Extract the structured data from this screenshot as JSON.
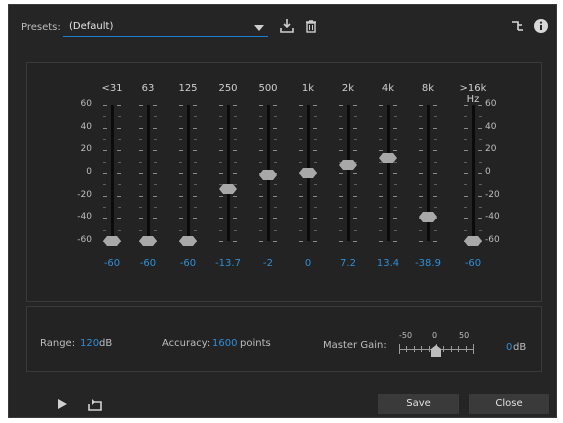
{
  "presets": {
    "label": "Presets:",
    "value": "(Default)"
  },
  "bands": [
    {
      "freq": "<31",
      "value": "-60",
      "gain": -60
    },
    {
      "freq": "63",
      "value": "-60",
      "gain": -60
    },
    {
      "freq": "125",
      "value": "-60",
      "gain": -60
    },
    {
      "freq": "250",
      "value": "-13.7",
      "gain": -13.7
    },
    {
      "freq": "500",
      "value": "-2",
      "gain": -2
    },
    {
      "freq": "1k",
      "value": "0",
      "gain": 0
    },
    {
      "freq": "2k",
      "value": "7.2",
      "gain": 7.2
    },
    {
      "freq": "4k",
      "value": "13.4",
      "gain": 13.4
    },
    {
      "freq": "8k",
      "value": "-38.9",
      "gain": -38.9
    },
    {
      "freq": ">16k Hz",
      "value": "-60",
      "gain": -60
    }
  ],
  "scale": [
    "60",
    "40",
    "20",
    "0",
    "-20",
    "-40",
    "-60"
  ],
  "range": {
    "label": "Range:",
    "value": "120",
    "unit": "dB"
  },
  "accuracy": {
    "label": "Accuracy:",
    "value": "1600",
    "unit": "points"
  },
  "master_gain": {
    "label": "Master Gain:",
    "scale": [
      "-50",
      "0",
      "50"
    ],
    "value": "0",
    "unit": "dB",
    "gain": 0
  },
  "buttons": {
    "save": "Save",
    "close": "Close"
  },
  "icons": [
    "save-preset-icon",
    "delete-preset-icon",
    "routing-icon",
    "info-icon",
    "play-icon",
    "loop-icon"
  ],
  "colors": {
    "accent": "#2d8fd8",
    "panel": "#252525"
  }
}
